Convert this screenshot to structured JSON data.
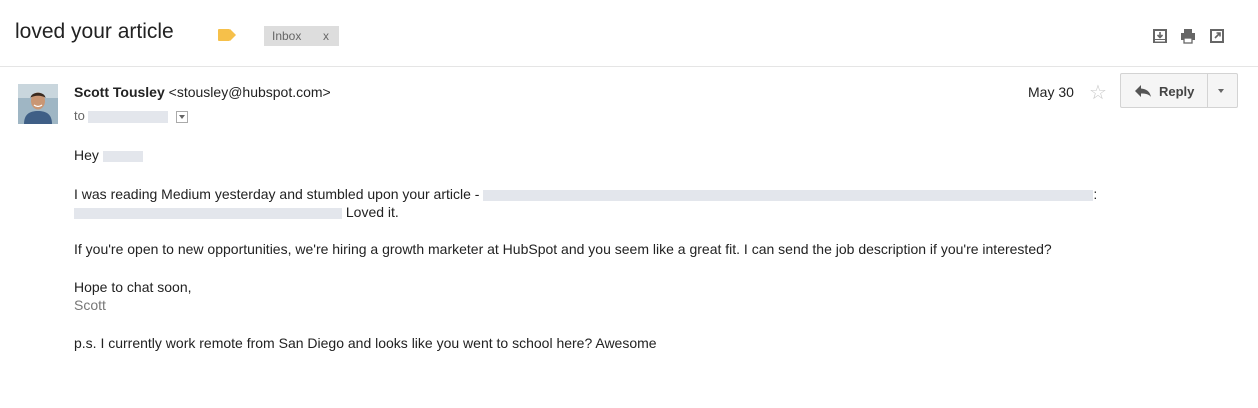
{
  "email": {
    "subject": "loved your article",
    "label_color": "#f6c04a",
    "inbox_label": "Inbox",
    "inbox_remove": "x",
    "toolbar_icons": [
      "download-icon",
      "print-icon",
      "new-window-icon"
    ]
  },
  "message": {
    "sender_name": "Scott Tousley",
    "sender_email": "<stousley@hubspot.com>",
    "to_prefix": "to",
    "date": "May 30",
    "star": "☆",
    "reply_label": "Reply",
    "greeting": "Hey",
    "line1_start": "I was reading Medium yesterday and stumbled upon your article -",
    "line1_end": "Loved it.",
    "line1_colon": ":",
    "para2": "If you're open to new opportunities, we're hiring a growth marketer at HubSpot and you seem like a great fit. I can send the job description if you're interested?",
    "closing": "Hope to chat soon,",
    "signature": "Scott",
    "postscript": "p.s. I currently work remote from San Diego and looks like you went to school here? Awesome"
  }
}
